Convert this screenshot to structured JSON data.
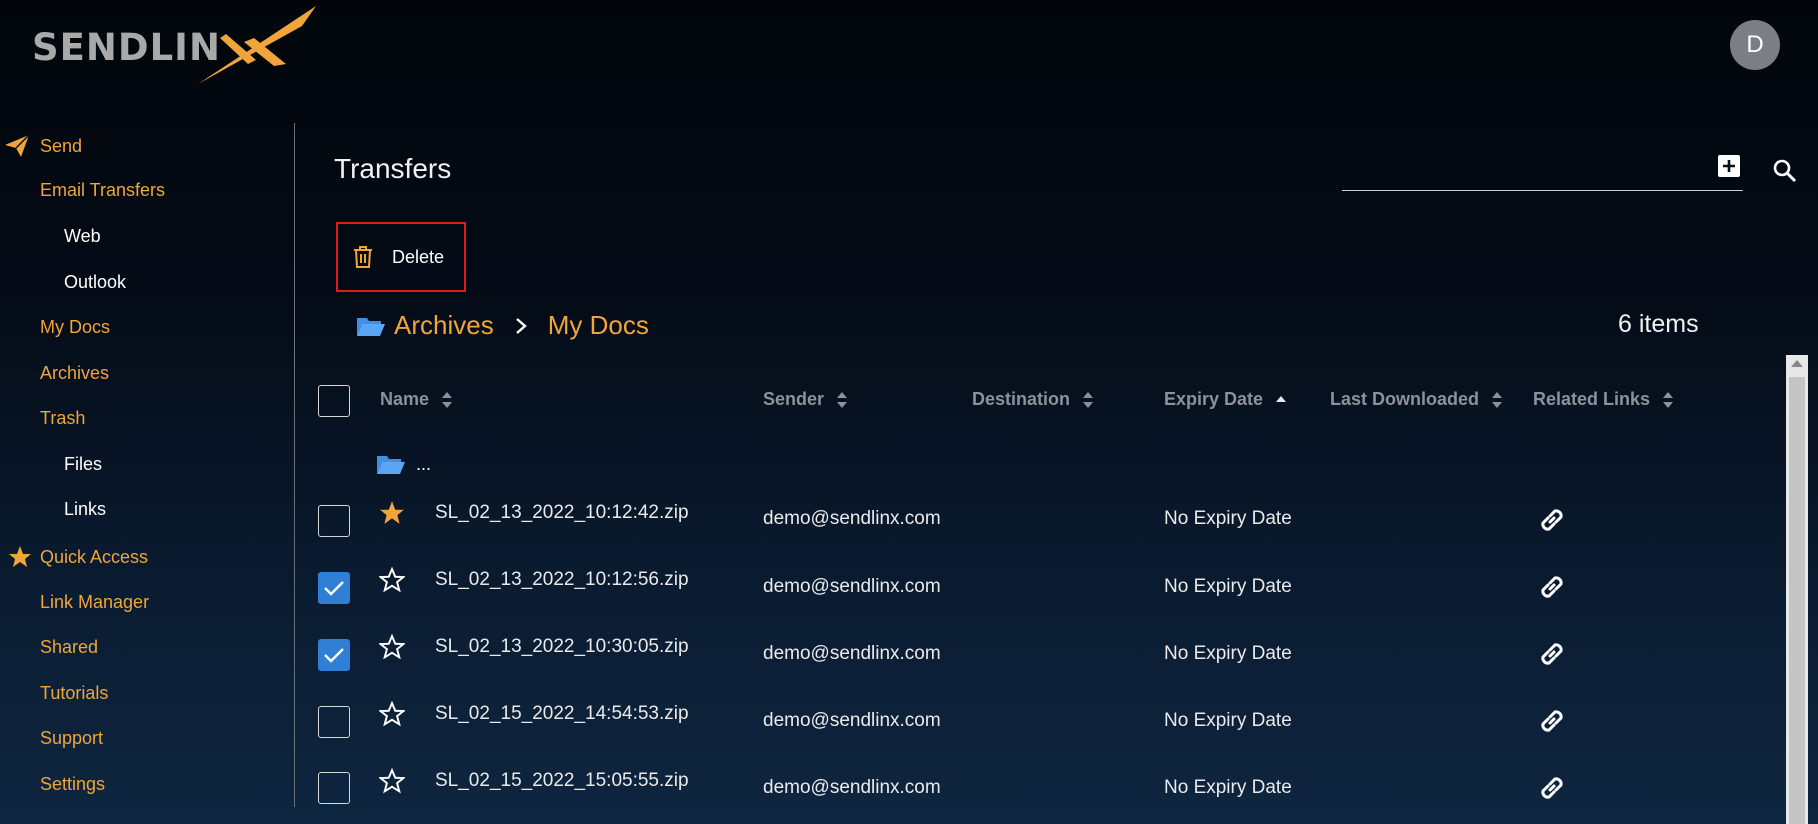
{
  "brand": {
    "logo_text": "SENDLIN",
    "avatar_initial": "D"
  },
  "sidebar": {
    "send": "Send",
    "email_transfers": "Email Transfers",
    "web": "Web",
    "outlook": "Outlook",
    "my_docs": "My Docs",
    "archives": "Archives",
    "trash": "Trash",
    "files": "Files",
    "links": "Links",
    "quick_access": "Quick Access",
    "link_manager": "Link Manager",
    "shared": "Shared",
    "tutorials": "Tutorials",
    "support": "Support",
    "settings": "Settings"
  },
  "main": {
    "title": "Transfers",
    "delete_label": "Delete",
    "breadcrumb": [
      "Archives",
      "My Docs"
    ],
    "item_count": "6 items",
    "parent_folder": "...",
    "columns": [
      "Name",
      "Sender",
      "Destination",
      "Expiry Date",
      "Last Downloaded",
      "Related Links"
    ],
    "rows": [
      {
        "name": "SL_02_13_2022_10:12:42.zip",
        "sender": "demo@sendlinx.com",
        "destination": "",
        "expiry": "No Expiry Date",
        "last_downloaded": "",
        "starred": true,
        "checked": false
      },
      {
        "name": "SL_02_13_2022_10:12:56.zip",
        "sender": "demo@sendlinx.com",
        "destination": "",
        "expiry": "No Expiry Date",
        "last_downloaded": "",
        "starred": false,
        "checked": true
      },
      {
        "name": "SL_02_13_2022_10:30:05.zip",
        "sender": "demo@sendlinx.com",
        "destination": "",
        "expiry": "No Expiry Date",
        "last_downloaded": "",
        "starred": false,
        "checked": true
      },
      {
        "name": "SL_02_15_2022_14:54:53.zip",
        "sender": "demo@sendlinx.com",
        "destination": "",
        "expiry": "No Expiry Date",
        "last_downloaded": "",
        "starred": false,
        "checked": false
      },
      {
        "name": "SL_02_15_2022_15:05:55.zip",
        "sender": "demo@sendlinx.com",
        "destination": "",
        "expiry": "No Expiry Date",
        "last_downloaded": "",
        "starred": false,
        "checked": false
      }
    ]
  },
  "colors": {
    "accent": "#f0a53a",
    "checkbox_checked": "#2f7fd6",
    "highlight_border": "#e01919",
    "folder": "#3d8fe8"
  },
  "icons": [
    "paper-plane-icon",
    "star-icon",
    "plus-square-icon",
    "search-icon",
    "trash-icon",
    "folder-open-icon",
    "chevron-right-icon",
    "sort-icon",
    "sort-asc-icon",
    "link-icon",
    "check-icon"
  ]
}
